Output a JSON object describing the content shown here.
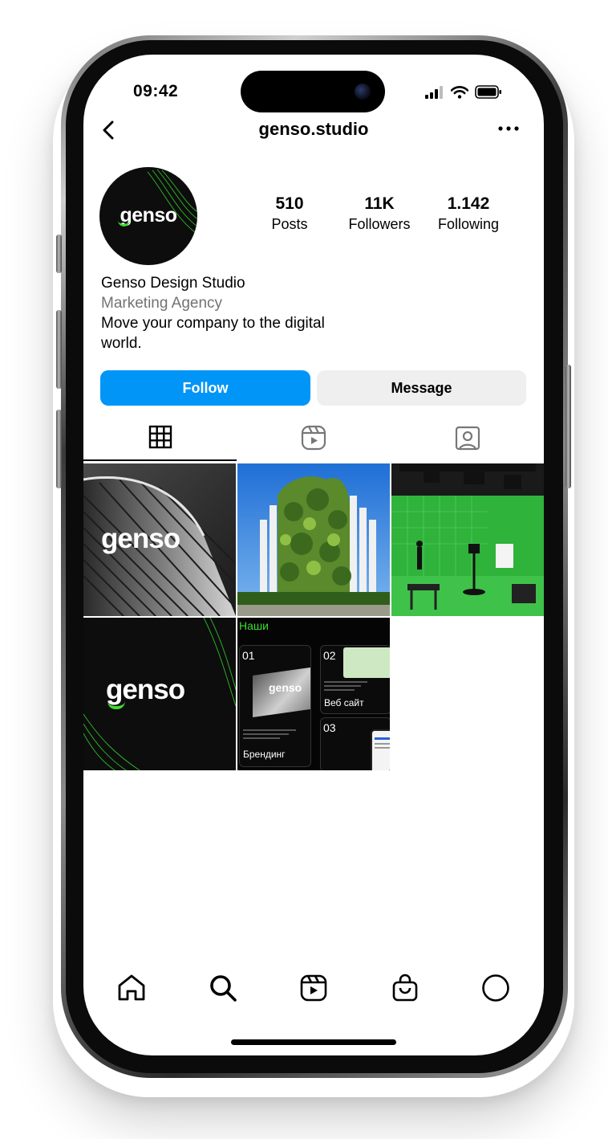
{
  "status": {
    "time": "09:42"
  },
  "header": {
    "username": "genso.studio"
  },
  "profile": {
    "avatar_text": "genso",
    "stats": [
      {
        "value": "510",
        "label": "Posts"
      },
      {
        "value": "11K",
        "label": "Followers"
      },
      {
        "value": "1.142",
        "label": "Following"
      }
    ],
    "name": "Genso Design Studio",
    "category": "Marketing Agency",
    "bio": "Move your company to the digital world."
  },
  "actions": {
    "follow": "Follow",
    "message": "Message"
  },
  "tabs": [
    {
      "icon": "grid-icon",
      "active": true
    },
    {
      "icon": "reels-icon",
      "active": false
    },
    {
      "icon": "tagged-icon",
      "active": false
    }
  ],
  "posts": {
    "tile1": {
      "logo_text": "genso"
    },
    "tile4": {
      "logo_text": "genso"
    },
    "tile5": {
      "heading": "Наши",
      "card1_num": "01",
      "card1_title": "Брендинг",
      "card1_logo": "genso",
      "card2_num": "02",
      "card2_title": "Веб сайт",
      "card3_num": "03"
    }
  },
  "colors": {
    "brand_green": "#3ddc2f",
    "follow_blue": "#0095f6",
    "message_gray": "#efefef",
    "category_gray": "#737373"
  },
  "bottom_nav": [
    "home-icon",
    "search-icon",
    "reels-icon",
    "shop-icon",
    "profile-icon"
  ]
}
